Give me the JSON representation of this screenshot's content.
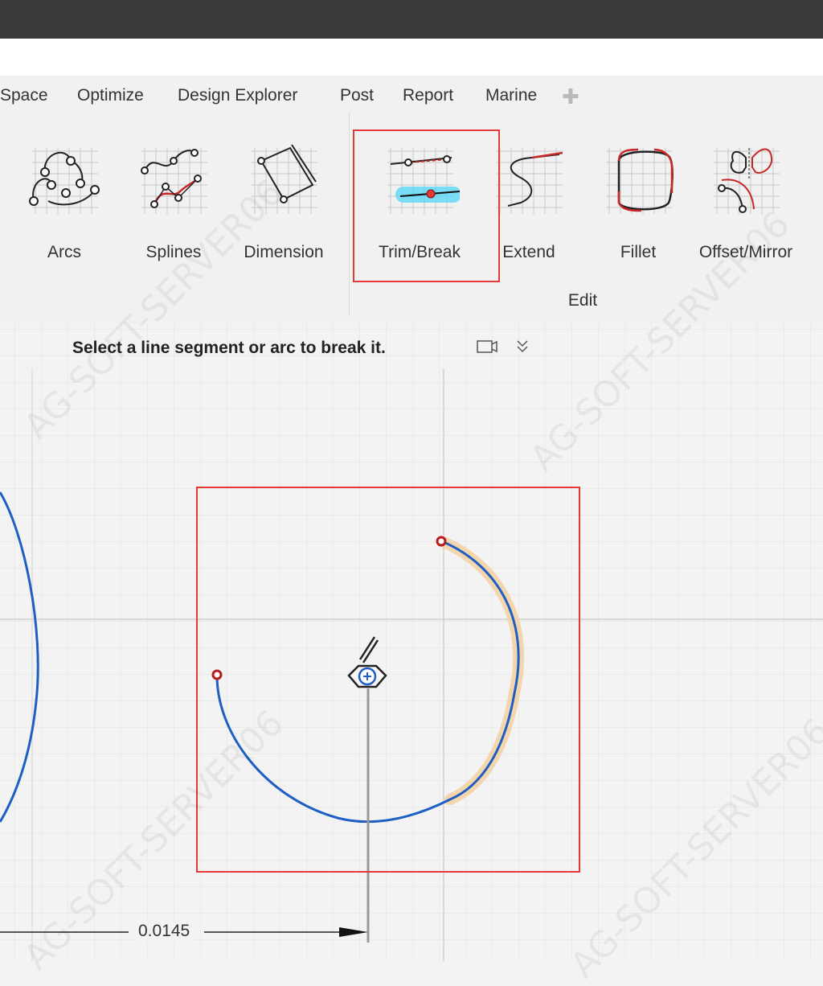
{
  "menu": {
    "items": [
      "Space",
      "Optimize",
      "Design Explorer",
      "Post",
      "Report",
      "Marine"
    ],
    "add_icon": "plus-icon"
  },
  "tools": [
    {
      "label": "Arcs",
      "icon": "arcs-icon"
    },
    {
      "label": "Splines",
      "icon": "splines-icon"
    },
    {
      "label": "Dimension",
      "icon": "dimension-icon"
    },
    {
      "label": "Trim/Break",
      "icon": "trim-break-icon",
      "selected": true
    },
    {
      "label": "Extend",
      "icon": "extend-icon"
    },
    {
      "label": "Fillet",
      "icon": "fillet-icon"
    },
    {
      "label": "Offset/Mirror",
      "icon": "offset-mirror-icon"
    }
  ],
  "group_label": "Edit",
  "prompt": {
    "text": "Select a line segment or arc to break it.",
    "icons": [
      "video-icon",
      "double-chevron-down-icon"
    ]
  },
  "dimension": {
    "value": "0.0145"
  },
  "colors": {
    "highlight": "#e53935",
    "curve": "#1f5fc4",
    "endpoint": "#b71c1c",
    "hover_glow": "#f3d3a6",
    "titlebar": "#3b3839"
  }
}
